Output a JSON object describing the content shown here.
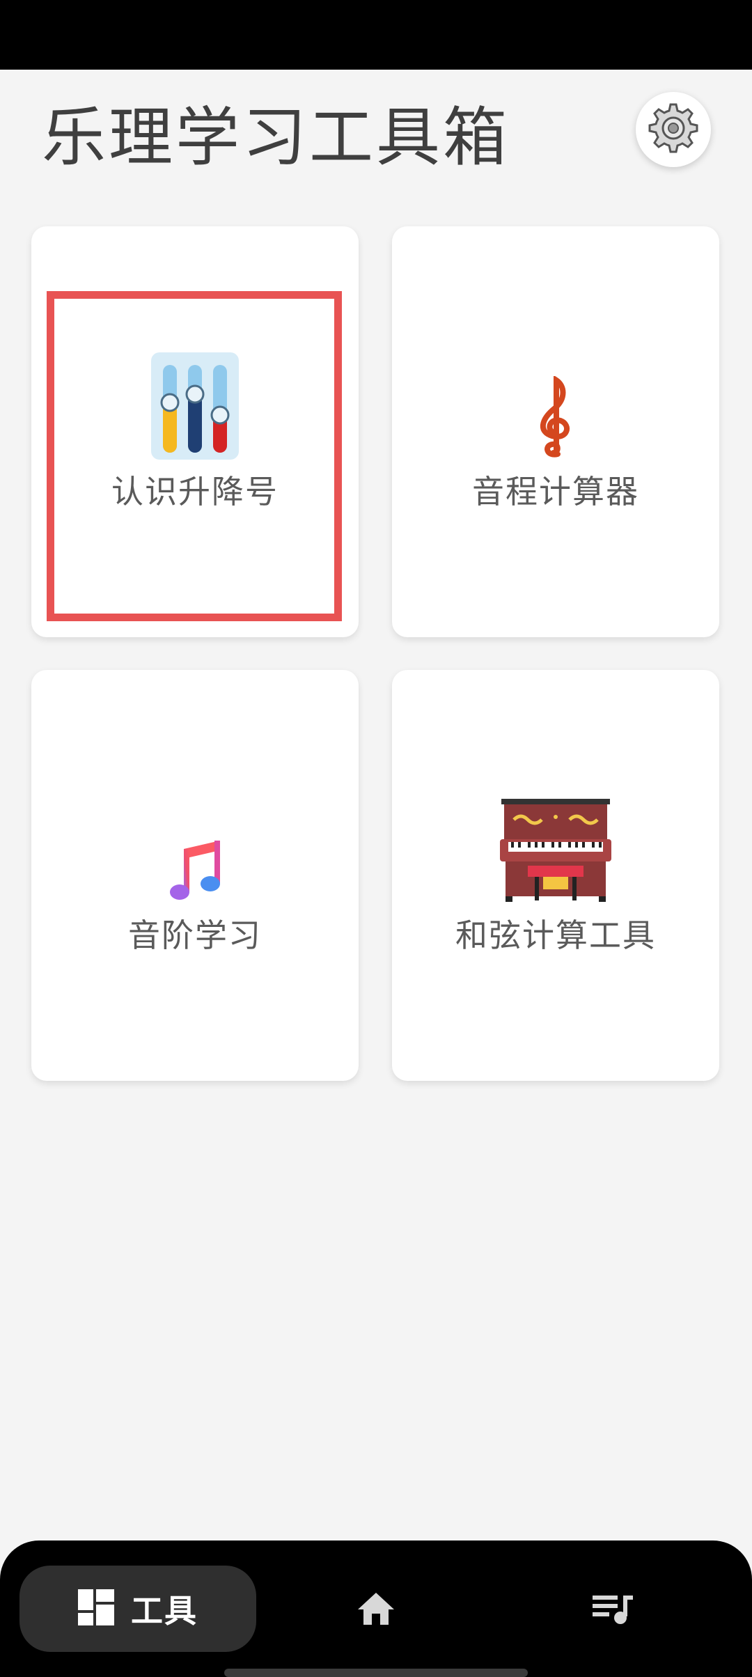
{
  "header": {
    "title": "乐理学习工具箱"
  },
  "icons": {
    "settings": "gear-icon",
    "sliders": "sliders-icon",
    "treble_clef": "treble-clef-icon",
    "music_note": "music-note-icon",
    "piano": "piano-icon",
    "tools": "dashboard-icon",
    "home": "home-icon",
    "playlist": "playlist-icon"
  },
  "cards": [
    {
      "label": "认识升降号"
    },
    {
      "label": "音程计算器"
    },
    {
      "label": "音阶学习"
    },
    {
      "label": "和弦计算工具"
    }
  ],
  "bottom_nav": {
    "tools_label": "工具"
  },
  "colors": {
    "highlight": "#e85353",
    "background": "#f4f4f4"
  }
}
